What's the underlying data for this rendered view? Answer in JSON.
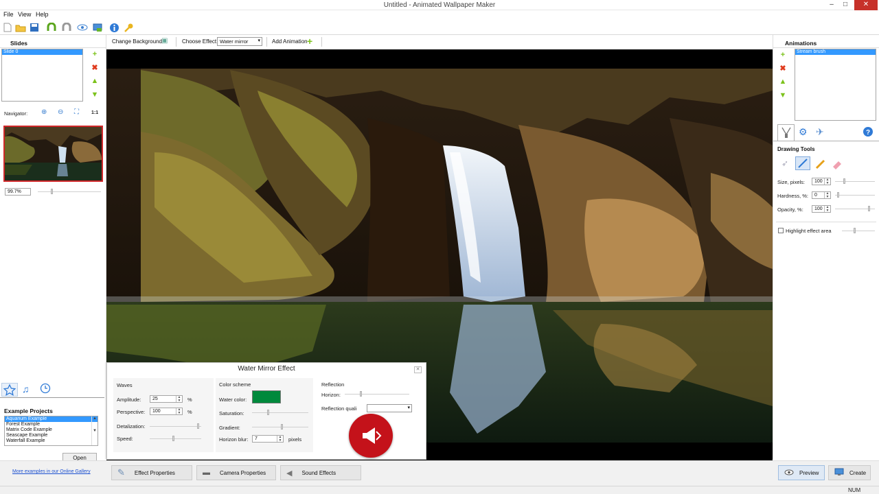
{
  "window": {
    "title": "Untitled - Animated Wallpaper Maker",
    "min": "–",
    "max": "□",
    "close": "✕"
  },
  "menu": [
    "File",
    "View",
    "Help"
  ],
  "effectbar": {
    "change_background": "Change Background",
    "choose_effect": "Choose Effect:",
    "effect_value": "Water mirror",
    "add_animation": "Add Animation"
  },
  "left": {
    "slides_header": "Slides",
    "slides": [
      "Slide 0"
    ],
    "navigator_label": "Navigator:",
    "zoom_1to1": "1:1",
    "zoom_value": "99.7%",
    "example_header": "Example Projects",
    "examples": [
      "Aquarium Example",
      "Forest Example",
      "Matrix Code Example",
      "Seascape Example",
      "Waterfall Example"
    ],
    "open_button": "Open",
    "gallery_link": "More examples in our Online Gallery"
  },
  "dialog": {
    "title": "Water Mirror Effect",
    "waves": {
      "header": "Waves",
      "amplitude_label": "Amplitude:",
      "amplitude_value": "25",
      "amplitude_unit": "%",
      "perspective_label": "Perspective:",
      "perspective_value": "100",
      "perspective_unit": "%",
      "detalization_label": "Detalization:",
      "speed_label": "Speed:"
    },
    "color": {
      "header": "Color scheme",
      "water_color_label": "Water color:",
      "water_color": "#00893c",
      "saturation_label": "Saturation:",
      "gradient_label": "Gradient:",
      "horizon_blur_label": "Horizon blur:",
      "horizon_blur_value": "7",
      "horizon_blur_unit": "pixels"
    },
    "reflection": {
      "header": "Reflection",
      "horizon_label": "Horizon:",
      "quality_label": "Reflection quali"
    }
  },
  "right": {
    "animations_header": "Animations",
    "animations": [
      "Stream brush"
    ],
    "drawing_tools_header": "Drawing Tools",
    "size_label": "Size, pixels:",
    "size_value": "100",
    "hardness_label": "Hardness, %:",
    "hardness_value": "0",
    "opacity_label": "Opacity, %:",
    "opacity_value": "100",
    "highlight_label": "Highlight effect area"
  },
  "bottom": {
    "effect_properties": "Effect Properties",
    "camera_properties": "Camera Properties",
    "sound_effects": "Sound Effects",
    "preview": "Preview",
    "create": "Create"
  },
  "status": {
    "num": "NUM"
  }
}
